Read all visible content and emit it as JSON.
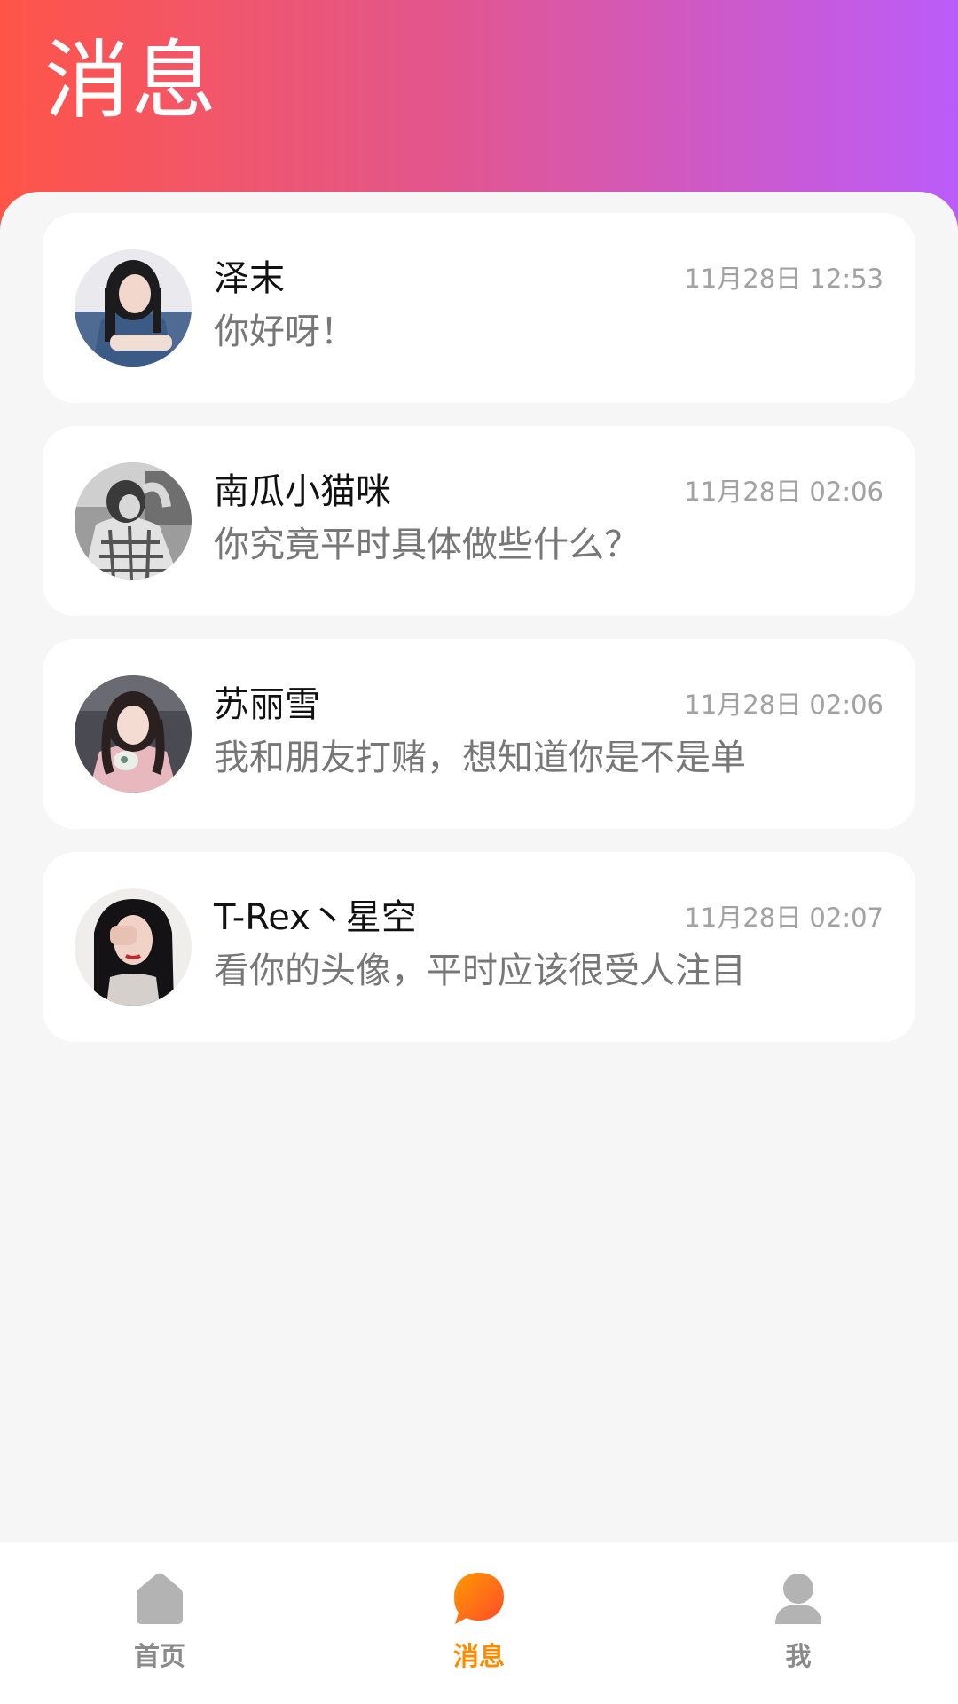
{
  "header": {
    "title": "消息"
  },
  "conversations": [
    {
      "name": "泽末",
      "time": "11月28日 12:53",
      "preview": "你好呀！",
      "avatar": "avatar-photo-1"
    },
    {
      "name": "南瓜小猫咪",
      "time": "11月28日 02:06",
      "preview": "你究竟平时具体做些什么？",
      "avatar": "avatar-photo-2"
    },
    {
      "name": "苏丽雪",
      "time": "11月28日 02:06",
      "preview": "我和朋友打赌，想知道你是不是单",
      "avatar": "avatar-photo-3"
    },
    {
      "name": "T-Rex丶星空",
      "time": "11月28日 02:07",
      "preview": "看你的头像，平时应该很受人注目",
      "avatar": "avatar-photo-4"
    }
  ],
  "tabbar": {
    "items": [
      {
        "label": "首页",
        "icon": "home-icon",
        "active": false
      },
      {
        "label": "消息",
        "icon": "chat-bubble-icon",
        "active": true
      },
      {
        "label": "我",
        "icon": "user-icon",
        "active": false
      }
    ]
  },
  "colors": {
    "header_gradient_start": "#ff5548",
    "header_gradient_end": "#bb5cfa",
    "active_tab": "#ff8a00",
    "inactive_tab": "#8a8a8a"
  }
}
